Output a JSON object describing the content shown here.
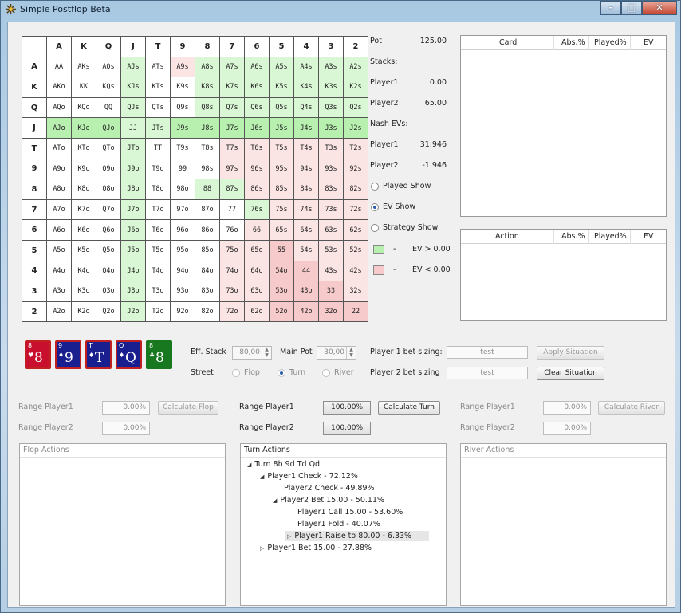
{
  "window": {
    "title": "Simple Postflop Beta",
    "min_icon": "minimize-icon",
    "max_icon": "maximize-icon",
    "close_icon": "close-icon"
  },
  "grid": {
    "headers": [
      "A",
      "K",
      "Q",
      "J",
      "T",
      "9",
      "8",
      "7",
      "6",
      "5",
      "4",
      "3",
      "2"
    ],
    "rows": [
      [
        [
          "AA",
          "w"
        ],
        [
          "AKs",
          "w"
        ],
        [
          "AQs",
          "w"
        ],
        [
          "AJs",
          "g"
        ],
        [
          "ATs",
          "w"
        ],
        [
          "A9s",
          "r"
        ],
        [
          "A8s",
          "g"
        ],
        [
          "A7s",
          "g"
        ],
        [
          "A6s",
          "g"
        ],
        [
          "A5s",
          "g"
        ],
        [
          "A4s",
          "g"
        ],
        [
          "A3s",
          "g"
        ],
        [
          "A2s",
          "g"
        ]
      ],
      [
        [
          "AKo",
          "w"
        ],
        [
          "KK",
          "w"
        ],
        [
          "KQs",
          "w"
        ],
        [
          "KJs",
          "g"
        ],
        [
          "KTs",
          "w"
        ],
        [
          "K9s",
          "w"
        ],
        [
          "K8s",
          "g"
        ],
        [
          "K7s",
          "g"
        ],
        [
          "K6s",
          "g"
        ],
        [
          "K5s",
          "g"
        ],
        [
          "K4s",
          "g"
        ],
        [
          "K3s",
          "g"
        ],
        [
          "K2s",
          "g"
        ]
      ],
      [
        [
          "AQo",
          "w"
        ],
        [
          "KQo",
          "w"
        ],
        [
          "QQ",
          "w"
        ],
        [
          "QJs",
          "g"
        ],
        [
          "QTs",
          "w"
        ],
        [
          "Q9s",
          "w"
        ],
        [
          "Q8s",
          "g"
        ],
        [
          "Q7s",
          "g"
        ],
        [
          "Q6s",
          "g"
        ],
        [
          "Q5s",
          "g"
        ],
        [
          "Q4s",
          "g"
        ],
        [
          "Q3s",
          "g"
        ],
        [
          "Q2s",
          "g"
        ]
      ],
      [
        [
          "AJo",
          "G"
        ],
        [
          "KJo",
          "G"
        ],
        [
          "QJo",
          "G"
        ],
        [
          "JJ",
          "g"
        ],
        [
          "JTs",
          "g"
        ],
        [
          "J9s",
          "G"
        ],
        [
          "J8s",
          "G"
        ],
        [
          "J7s",
          "G"
        ],
        [
          "J6s",
          "G"
        ],
        [
          "J5s",
          "G"
        ],
        [
          "J4s",
          "G"
        ],
        [
          "J3s",
          "G"
        ],
        [
          "J2s",
          "G"
        ]
      ],
      [
        [
          "ATo",
          "w"
        ],
        [
          "KTo",
          "w"
        ],
        [
          "QTo",
          "w"
        ],
        [
          "JTo",
          "g"
        ],
        [
          "TT",
          "w"
        ],
        [
          "T9s",
          "w"
        ],
        [
          "T8s",
          "w"
        ],
        [
          "T7s",
          "r"
        ],
        [
          "T6s",
          "r"
        ],
        [
          "T5s",
          "r"
        ],
        [
          "T4s",
          "r"
        ],
        [
          "T3s",
          "r"
        ],
        [
          "T2s",
          "r"
        ]
      ],
      [
        [
          "A9o",
          "w"
        ],
        [
          "K9o",
          "w"
        ],
        [
          "Q9o",
          "w"
        ],
        [
          "J9o",
          "g"
        ],
        [
          "T9o",
          "w"
        ],
        [
          "99",
          "w"
        ],
        [
          "98s",
          "w"
        ],
        [
          "97s",
          "r"
        ],
        [
          "96s",
          "r"
        ],
        [
          "95s",
          "r"
        ],
        [
          "94s",
          "r"
        ],
        [
          "93s",
          "r"
        ],
        [
          "92s",
          "r"
        ]
      ],
      [
        [
          "A8o",
          "w"
        ],
        [
          "K8o",
          "w"
        ],
        [
          "Q8o",
          "w"
        ],
        [
          "J8o",
          "g"
        ],
        [
          "T8o",
          "w"
        ],
        [
          "98o",
          "w"
        ],
        [
          "88",
          "g"
        ],
        [
          "87s",
          "g"
        ],
        [
          "86s",
          "r"
        ],
        [
          "85s",
          "r"
        ],
        [
          "84s",
          "r"
        ],
        [
          "83s",
          "r"
        ],
        [
          "82s",
          "r"
        ]
      ],
      [
        [
          "A7o",
          "w"
        ],
        [
          "K7o",
          "w"
        ],
        [
          "Q7o",
          "w"
        ],
        [
          "J7o",
          "g"
        ],
        [
          "T7o",
          "w"
        ],
        [
          "97o",
          "w"
        ],
        [
          "87o",
          "w"
        ],
        [
          "77",
          "w"
        ],
        [
          "76s",
          "g"
        ],
        [
          "75s",
          "r"
        ],
        [
          "74s",
          "r"
        ],
        [
          "73s",
          "r"
        ],
        [
          "72s",
          "r"
        ]
      ],
      [
        [
          "A6o",
          "w"
        ],
        [
          "K6o",
          "w"
        ],
        [
          "Q6o",
          "w"
        ],
        [
          "J6o",
          "g"
        ],
        [
          "T6o",
          "w"
        ],
        [
          "96o",
          "w"
        ],
        [
          "86o",
          "w"
        ],
        [
          "76o",
          "w"
        ],
        [
          "66",
          "r"
        ],
        [
          "65s",
          "r"
        ],
        [
          "64s",
          "r"
        ],
        [
          "63s",
          "r"
        ],
        [
          "62s",
          "r"
        ]
      ],
      [
        [
          "A5o",
          "w"
        ],
        [
          "K5o",
          "w"
        ],
        [
          "Q5o",
          "w"
        ],
        [
          "J5o",
          "g"
        ],
        [
          "T5o",
          "w"
        ],
        [
          "95o",
          "w"
        ],
        [
          "85o",
          "w"
        ],
        [
          "75o",
          "r"
        ],
        [
          "65o",
          "r"
        ],
        [
          "55",
          "R"
        ],
        [
          "54s",
          "r"
        ],
        [
          "53s",
          "r"
        ],
        [
          "52s",
          "r"
        ]
      ],
      [
        [
          "A4o",
          "w"
        ],
        [
          "K4o",
          "w"
        ],
        [
          "Q4o",
          "w"
        ],
        [
          "J4o",
          "g"
        ],
        [
          "T4o",
          "w"
        ],
        [
          "94o",
          "w"
        ],
        [
          "84o",
          "w"
        ],
        [
          "74o",
          "r"
        ],
        [
          "64o",
          "r"
        ],
        [
          "54o",
          "R"
        ],
        [
          "44",
          "R"
        ],
        [
          "43s",
          "r"
        ],
        [
          "42s",
          "r"
        ]
      ],
      [
        [
          "A3o",
          "w"
        ],
        [
          "K3o",
          "w"
        ],
        [
          "Q3o",
          "w"
        ],
        [
          "J3o",
          "g"
        ],
        [
          "T3o",
          "w"
        ],
        [
          "93o",
          "w"
        ],
        [
          "83o",
          "w"
        ],
        [
          "73o",
          "r"
        ],
        [
          "63o",
          "r"
        ],
        [
          "53o",
          "R"
        ],
        [
          "43o",
          "R"
        ],
        [
          "33",
          "R"
        ],
        [
          "32s",
          "r"
        ]
      ],
      [
        [
          "A2o",
          "w"
        ],
        [
          "K2o",
          "w"
        ],
        [
          "Q2o",
          "w"
        ],
        [
          "J2o",
          "g"
        ],
        [
          "T2o",
          "w"
        ],
        [
          "92o",
          "w"
        ],
        [
          "82o",
          "w"
        ],
        [
          "72o",
          "r"
        ],
        [
          "62o",
          "r"
        ],
        [
          "52o",
          "R"
        ],
        [
          "42o",
          "R"
        ],
        [
          "32o",
          "R"
        ],
        [
          "22",
          "R"
        ]
      ]
    ]
  },
  "info": {
    "pot_label": "Pot",
    "pot_value": "125.00",
    "stacks_label": "Stacks:",
    "p1_label": "Player1",
    "p1_stack": "0.00",
    "p2_label": "Player2",
    "p2_stack": "65.00",
    "nash_label": "Nash EVs:",
    "p1_ev_label": "Player1",
    "p1_ev": "31.946",
    "p2_ev_label": "Player2",
    "p2_ev": "-1.946",
    "played_show": "Played Show",
    "ev_show": "EV Show",
    "strategy_show": "Strategy Show",
    "legend_pos": "EV > 0.00",
    "legend_neg": "EV < 0.00",
    "dash": "-",
    "color_pos": "#b8f0b0",
    "color_neg": "#f6caca"
  },
  "card_table": {
    "col_card": "Card",
    "col_abs": "Abs.%",
    "col_played": "Played%",
    "col_ev": "EV"
  },
  "action_table": {
    "col_action": "Action",
    "col_abs": "Abs.%",
    "col_played": "Played%",
    "col_ev": "EV"
  },
  "board": [
    {
      "rank": "8",
      "suit": "♥",
      "color": "#c8102e"
    },
    {
      "rank": "9",
      "suit": "♦",
      "color": "#1a1f8f"
    },
    {
      "rank": "T",
      "suit": "♦",
      "color": "#1a1f8f"
    },
    {
      "rank": "Q",
      "suit": "♦",
      "color": "#1a1f8f"
    },
    {
      "rank": "8",
      "suit": "♣",
      "color": "#17781f"
    }
  ],
  "controls": {
    "eff_stack_label": "Eff. Stack",
    "eff_stack": "80,00",
    "main_pot_label": "Main Pot",
    "main_pot": "30,00",
    "street_label": "Street",
    "street_flop": "Flop",
    "street_turn": "Turn",
    "street_river": "River",
    "p1_sizing_label": "Player 1 bet sizing:",
    "p1_sizing": "test",
    "p2_sizing_label": "Player 2 bet sizing",
    "p2_sizing": "test",
    "apply_btn": "Apply Situation",
    "clear_btn": "Clear Situation"
  },
  "ranges": {
    "flop": {
      "p1_label": "Range Player1",
      "p1": "0.00%",
      "p2_label": "Range Player2",
      "p2": "0.00%",
      "btn": "Calculate Flop"
    },
    "turn": {
      "p1_label": "Range Player1",
      "p1": "100.00%",
      "p2_label": "Range Player2",
      "p2": "100.00%",
      "btn": "Calculate Turn"
    },
    "river": {
      "p1_label": "Range Player1",
      "p1": "0.00%",
      "p2_label": "Range Player2",
      "p2": "0.00%",
      "btn": "Calculate River"
    }
  },
  "panels": {
    "flop_title": "Flop Actions",
    "turn_title": "Turn Actions",
    "river_title": "River Actions"
  },
  "tree": [
    "Turn 8h 9d Td Qd",
    "Player1 Check - 72.12%",
    "Player2 Check - 49.89%",
    "Player2 Bet 15.00 - 50.11%",
    "Player1 Call 15.00 - 53.60%",
    "Player1 Fold - 40.07%",
    "Player1 Raise to 80.00 - 6.33%",
    "Player1 Bet 15.00 - 27.88%"
  ]
}
